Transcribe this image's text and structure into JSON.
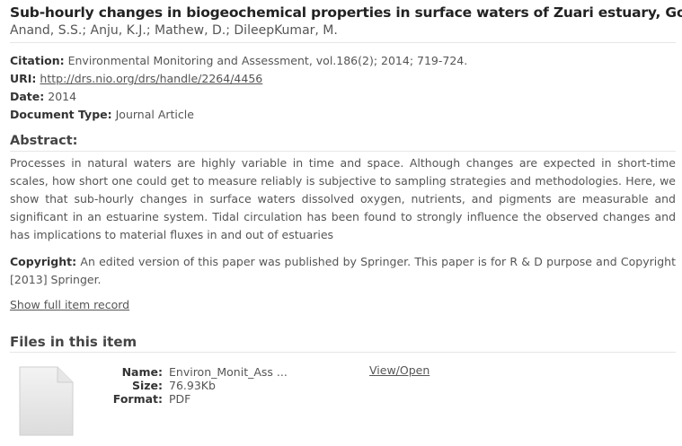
{
  "item": {
    "title": "Sub-hourly changes in biogeochemical properties in surface waters of Zuari estuary, Goa",
    "authors": "Anand, S.S.; Anju, K.J.; Mathew, D.; DileepKumar, M."
  },
  "metadata": {
    "citation_label": "Citation:",
    "citation_value": "Environmental Monitoring and Assessment, vol.186(2); 2014; 719-724.",
    "uri_label": "URI:",
    "uri_value": "http://drs.nio.org/drs/handle/2264/4456",
    "date_label": "Date:",
    "date_value": "2014",
    "doctype_label": "Document Type:",
    "doctype_value": "Journal Article"
  },
  "abstract": {
    "heading": "Abstract:",
    "text": "Processes in natural waters are highly variable in time and space. Although changes are expected in short-time scales, how short one could get to measure reliably is subjective to sampling strategies and methodologies. Here, we show that sub-hourly changes in surface waters dissolved oxygen, nutrients, and pigments are measurable and significant in an estuarine system. Tidal circulation has been found to strongly influence the observed changes and has implications to material fluxes in and out of estuaries"
  },
  "copyright": {
    "label": "Copyright:",
    "text": "An edited version of this paper was published by Springer. This paper is for R & D purpose and Copyright [2013] Springer."
  },
  "show_full_record": "Show full item record",
  "files": {
    "heading": "Files in this item",
    "icon": "generic-file-icon",
    "name_label": "Name:",
    "name_value": "Environ_Monit_Ass ...",
    "size_label": "Size:",
    "size_value": "76.93Kb",
    "format_label": "Format:",
    "format_value": "PDF",
    "view_open": "View/Open"
  }
}
